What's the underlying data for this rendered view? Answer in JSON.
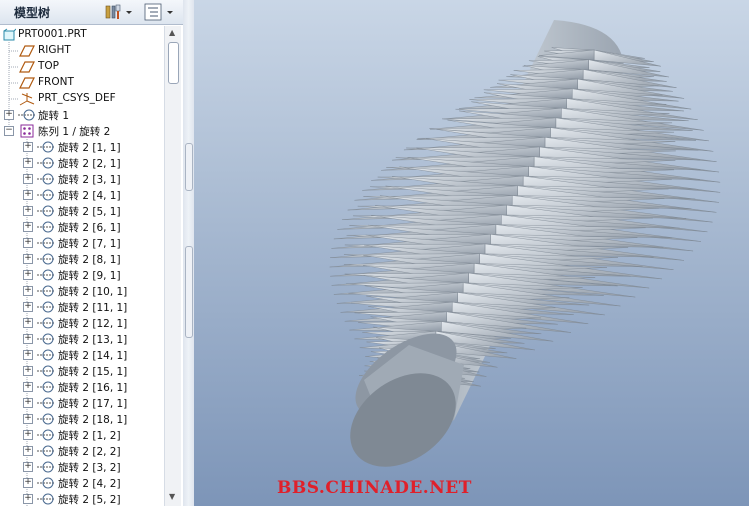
{
  "panel": {
    "title": "模型树",
    "settings_icon": "tools-settings-icon",
    "view_icon": "tree-view-icon"
  },
  "tree": {
    "root": "PRT0001.PRT",
    "datum_planes": [
      "RIGHT",
      "TOP",
      "FRONT"
    ],
    "csys": "PRT_CSYS_DEF",
    "feature": "旋转 1",
    "pattern": "陈列 1 / 旋转 2",
    "pattern_items": [
      "旋转 2 [1, 1]",
      "旋转 2 [2, 1]",
      "旋转 2 [3, 1]",
      "旋转 2 [4, 1]",
      "旋转 2 [5, 1]",
      "旋转 2 [6, 1]",
      "旋转 2 [7, 1]",
      "旋转 2 [8, 1]",
      "旋转 2 [9, 1]",
      "旋转 2 [10, 1]",
      "旋转 2 [11, 1]",
      "旋转 2 [12, 1]",
      "旋转 2 [13, 1]",
      "旋转 2 [14, 1]",
      "旋转 2 [15, 1]",
      "旋转 2 [16, 1]",
      "旋转 2 [17, 1]",
      "旋转 2 [18, 1]",
      "旋转 2 [1, 2]",
      "旋转 2 [2, 2]",
      "旋转 2 [3, 2]",
      "旋转 2 [4, 2]",
      "旋转 2 [5, 2]"
    ]
  },
  "viewport": {
    "model": "spiked-cylinder-model",
    "colors": {
      "model": "#b9c2cc",
      "background_top": "#c9d6e6",
      "background_bottom": "#7d95b8"
    }
  },
  "watermark": "BBS.CHINADE.NET"
}
